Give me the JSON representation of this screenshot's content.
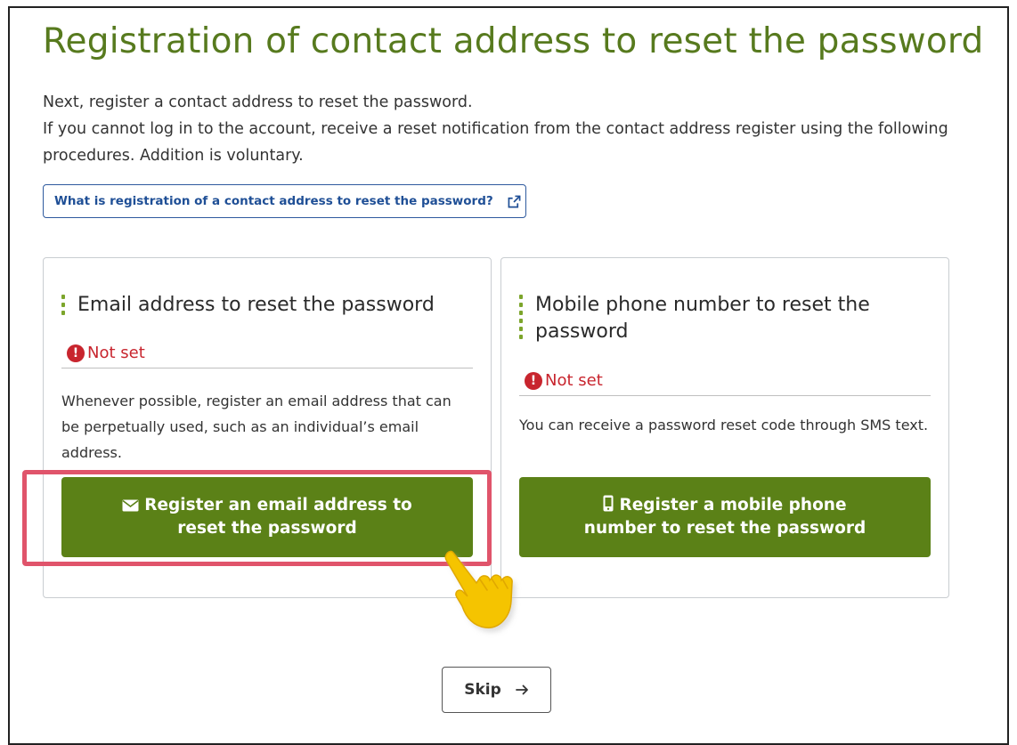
{
  "page": {
    "title": "Registration of contact address to reset the password",
    "intro_line1": "Next, register a contact address to reset the password.",
    "intro_line2": "If you cannot log in to the account, receive a reset notification from the contact address register using the following procedures. Addition is voluntary.",
    "help_link_label": "What is registration of a contact address to reset the password?",
    "help_link_icon": "external-link-icon"
  },
  "email_card": {
    "title": "Email address to reset the password",
    "status": "Not set",
    "status_icon": "exclamation-icon",
    "description": "Whenever possible, register an email address that can be perpetually used, such as an individual’s email address.",
    "button_label": "Register an email address to reset the password",
    "button_icon": "envelope-icon",
    "highlighted": true
  },
  "phone_card": {
    "title": "Mobile phone number to reset the password",
    "status": "Not set",
    "status_icon": "exclamation-icon",
    "description": "You can receive a password reset code through SMS text.",
    "button_label": "Register a mobile phone number to reset the password",
    "button_icon": "mobile-phone-icon"
  },
  "skip": {
    "label": "Skip",
    "icon": "arrow-right-icon"
  },
  "colors": {
    "title": "#577a1e",
    "primary_button": "#5b8117",
    "status_error": "#c8252e",
    "link": "#1f4f96",
    "highlight_border": "#e0546b",
    "pointer_hand": "#f5c400"
  }
}
